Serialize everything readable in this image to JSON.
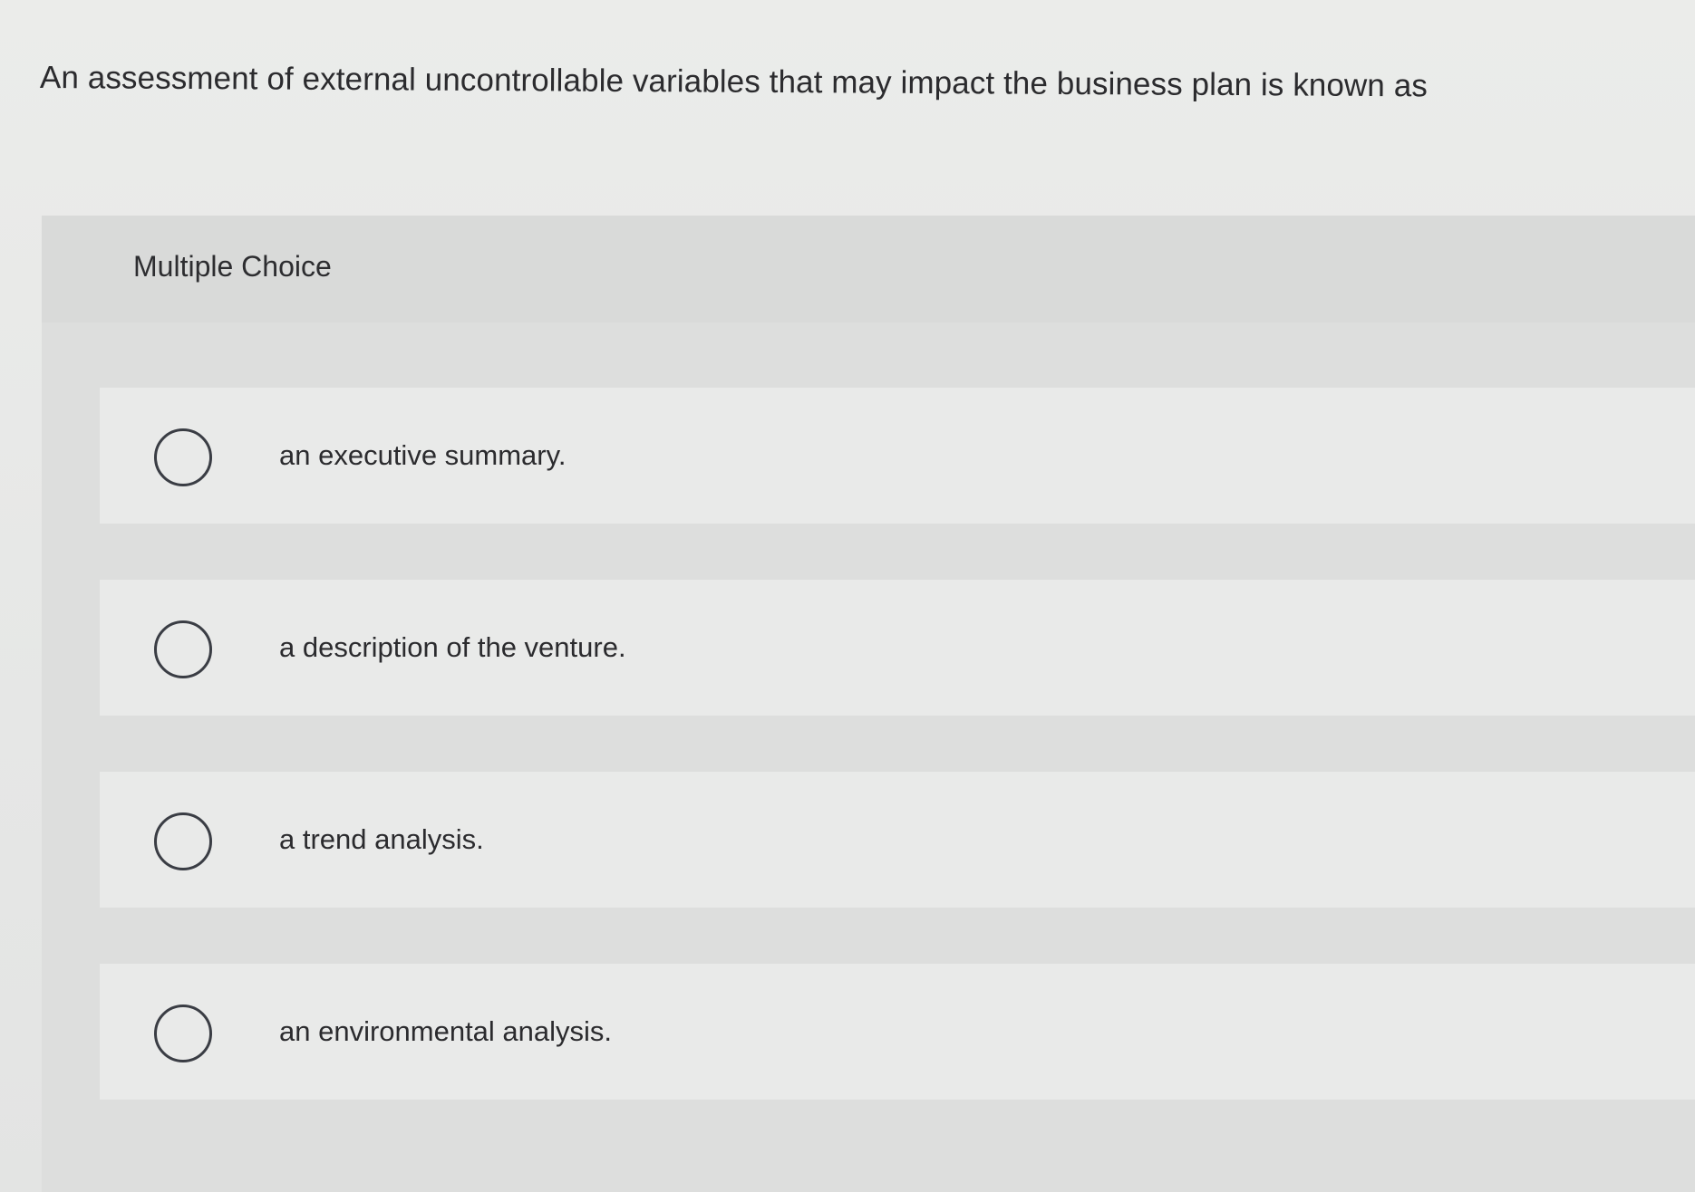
{
  "question": {
    "text": "An assessment of external uncontrollable variables that may impact the business plan is known as"
  },
  "multiple_choice": {
    "header_label": "Multiple Choice",
    "options": [
      {
        "label": "an executive summary."
      },
      {
        "label": "a description of the venture."
      },
      {
        "label": "a trend analysis."
      },
      {
        "label": "an environmental analysis."
      }
    ]
  }
}
